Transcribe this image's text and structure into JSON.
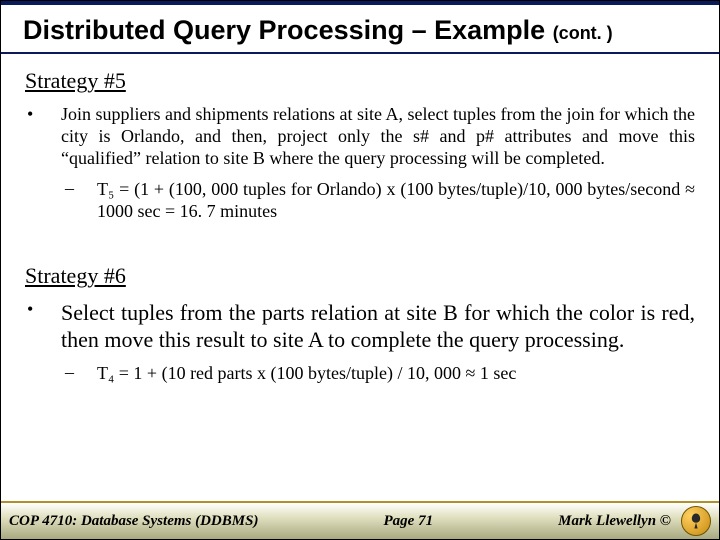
{
  "title_main": "Distributed Query Processing – Example ",
  "title_cont": "(cont. )",
  "strategy5": {
    "heading": "Strategy #5",
    "bullet": "Join suppliers and shipments relations at site A, select tuples from the join for which the city is Orlando, and then, project only the s# and p# attributes and move this “qualified” relation to site B where the query processing will be completed.",
    "sub": "T₅ = (1 + (100, 000 tuples for Orlando) x (100 bytes/tuple)/10, 000 bytes/second ≈ 1000 sec = 16. 7 minutes"
  },
  "strategy6": {
    "heading": "Strategy #6",
    "bullet": "Select tuples from the parts relation at site B for which the color is red,  then move this result to site A to complete the query processing.",
    "sub": "T₄ = 1 + (10 red parts x (100 bytes/tuple) / 10, 000 ≈ 1 sec"
  },
  "footer": {
    "course": "COP 4710: Database Systems  (DDBMS)",
    "page": "Page 71",
    "author": "Mark Llewellyn ©"
  }
}
